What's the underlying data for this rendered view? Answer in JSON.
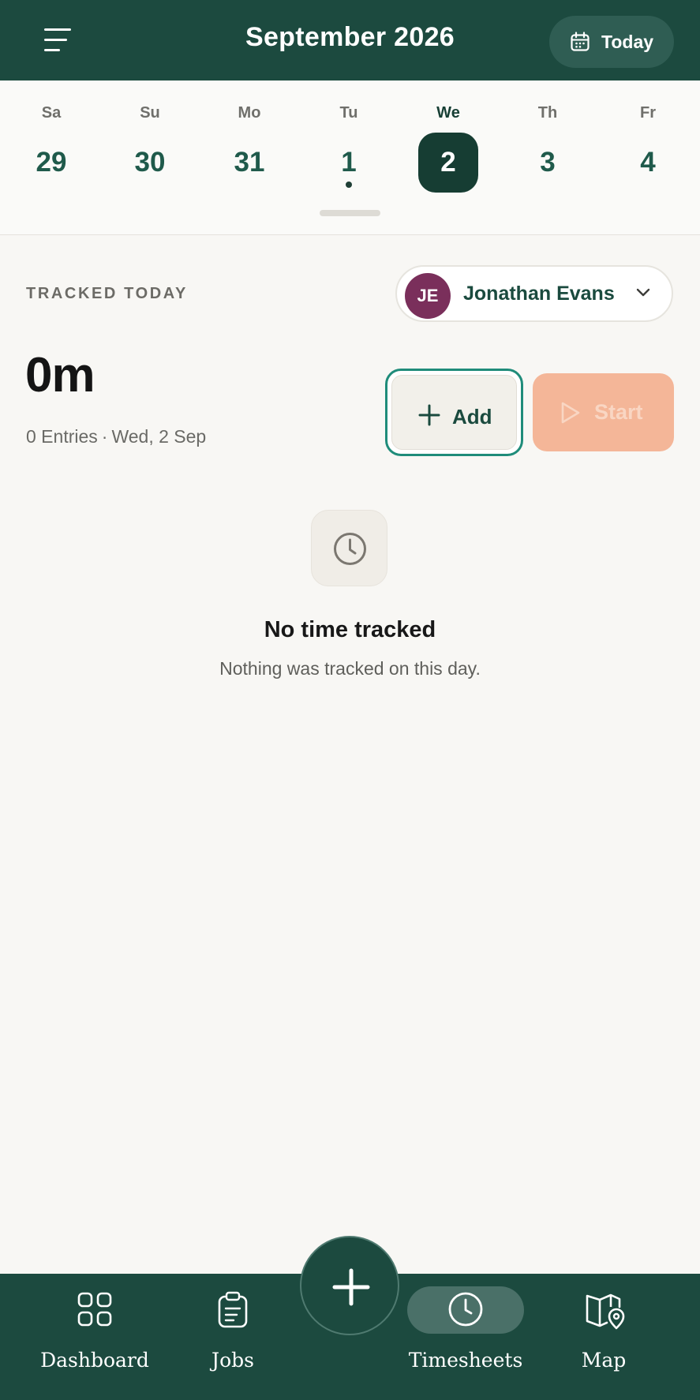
{
  "header": {
    "title": "September 2026",
    "menu_icon": "hamburger-menu-icon",
    "today_label": "Today",
    "today_icon": "calendar-icon",
    "background": "#1c4a3f"
  },
  "week": {
    "days": [
      {
        "dow": "Sa",
        "num": "29"
      },
      {
        "dow": "Su",
        "num": "30"
      },
      {
        "dow": "Mo",
        "num": "31"
      },
      {
        "dow": "Tu",
        "num": "1",
        "has_entries": true
      },
      {
        "dow": "We",
        "num": "2",
        "selected": true
      },
      {
        "dow": "Th",
        "num": "3"
      },
      {
        "dow": "Fr",
        "num": "4"
      }
    ]
  },
  "tracked": {
    "label": "TRACKED TODAY",
    "user": {
      "initials": "JE",
      "name": "Jonathan Evans",
      "avatar_color": "#7a2f5b"
    },
    "total": "0m",
    "entries": "0 Entries",
    "separator": "·",
    "date": "Wed, 2 Sep",
    "add_label": "Add",
    "start_label": "Start",
    "start_enabled": false,
    "accent": "#f4b698"
  },
  "empty_state": {
    "icon": "clock-icon",
    "title": "No time tracked",
    "subtitle": "Nothing was tracked on this day."
  },
  "nav": {
    "items": [
      {
        "label": "Dashboard",
        "icon": "grid-icon"
      },
      {
        "label": "Jobs",
        "icon": "clipboard-icon"
      },
      {
        "label": "Timesheets",
        "icon": "clock-icon",
        "active": true
      },
      {
        "label": "Map",
        "icon": "map-pin-icon"
      }
    ],
    "fab_icon": "plus-icon"
  }
}
